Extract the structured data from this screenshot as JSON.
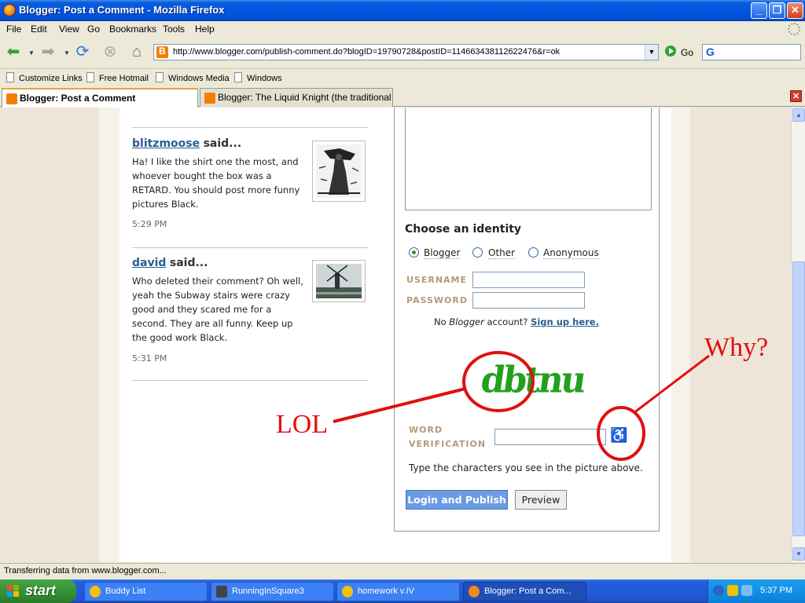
{
  "window": {
    "title": "Blogger: Post a Comment - Mozilla Firefox"
  },
  "menu": [
    "File",
    "Edit",
    "View",
    "Go",
    "Bookmarks",
    "Tools",
    "Help"
  ],
  "nav": {
    "url": "http://www.blogger.com/publish-comment.do?blogID=19790728&postID=114663438112622476&r=ok",
    "go_label": "Go",
    "search_icon": "G"
  },
  "bookmarks": [
    "Customize Links",
    "Free Hotmail",
    "Windows Media",
    "Windows"
  ],
  "tabs": [
    {
      "label": "Blogger: Post a Comment",
      "active": true
    },
    {
      "label": "Blogger: The Liquid Knight (the traditional tit...",
      "active": false
    }
  ],
  "comments": [
    {
      "author": "blitzmoose",
      "said": "said...",
      "body": "Ha! I like the shirt one the most, and whoever bought the box was a RETARD. You should post more funny pictures Black.",
      "time": "5:29 PM"
    },
    {
      "author": "david",
      "said": "said...",
      "body": "Who deleted their comment? Oh well, yeah the Subway stairs were crazy good and they scared me for a second. They are all funny. Keep up the good work Black.",
      "time": "5:31 PM"
    }
  ],
  "form": {
    "choose_identity": "Choose an identity",
    "identities": [
      "Blogger",
      "Other",
      "Anonymous"
    ],
    "selected_identity": "Blogger",
    "username_label": "USERNAME",
    "password_label": "PASSWORD",
    "no_account_prefix": "No",
    "no_account_brand": "Blogger",
    "no_account_suffix": "account?",
    "sign_up": "Sign up here.",
    "captcha_text": "dbtnu",
    "word_label_1": "WORD",
    "word_label_2": "VERIFICATION",
    "hint": "Type the characters you see in the picture above.",
    "publish_button": "Login and Publish",
    "preview_button": "Preview"
  },
  "annotations": {
    "lol": "LOL",
    "why": "Why?",
    "color": "#e01010"
  },
  "status": {
    "text": "Transferring data from www.blogger.com..."
  },
  "taskbar": {
    "start": "start",
    "tasks": [
      "Buddy List",
      "RunningInSquare3",
      "homework v.IV",
      "Blogger: Post a Com..."
    ],
    "clock": "5:37 PM"
  }
}
